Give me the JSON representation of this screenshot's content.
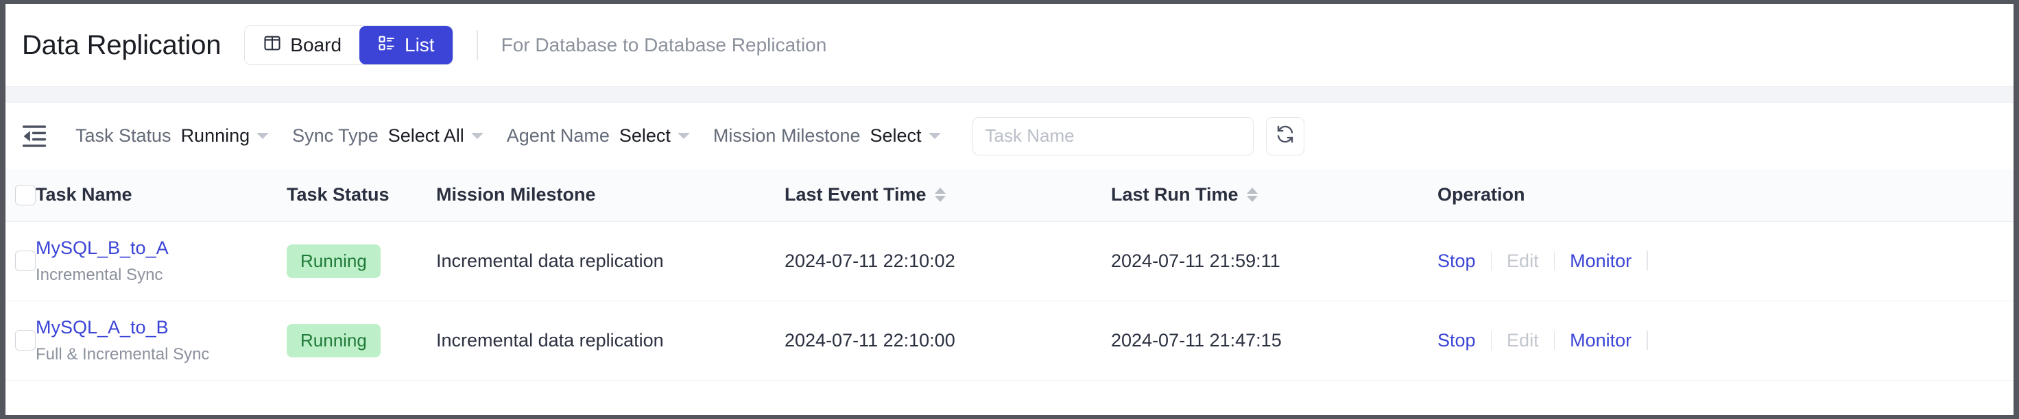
{
  "header": {
    "title": "Data Replication",
    "views": [
      {
        "label": "Board",
        "icon": "board-icon",
        "active": false
      },
      {
        "label": "List",
        "icon": "list-icon",
        "active": true
      }
    ],
    "subtitle": "For Database to Database Replication"
  },
  "filters": {
    "collapse_icon": "collapse-sidebar-icon",
    "items": [
      {
        "label": "Task Status",
        "value": "Running"
      },
      {
        "label": "Sync Type",
        "value": "Select All"
      },
      {
        "label": "Agent Name",
        "value": "Select"
      },
      {
        "label": "Mission Milestone",
        "value": "Select"
      }
    ],
    "search": {
      "placeholder": "Task Name",
      "value": ""
    },
    "refresh_icon": "refresh-icon"
  },
  "table": {
    "columns": [
      {
        "key": "name",
        "label": "Task Name",
        "sortable": false
      },
      {
        "key": "status",
        "label": "Task Status",
        "sortable": false
      },
      {
        "key": "mission",
        "label": "Mission Milestone",
        "sortable": false
      },
      {
        "key": "event_time",
        "label": "Last Event Time",
        "sortable": true
      },
      {
        "key": "run_time",
        "label": "Last Run Time",
        "sortable": true
      },
      {
        "key": "operation",
        "label": "Operation",
        "sortable": false
      }
    ],
    "rows": [
      {
        "name": "MySQL_B_to_A",
        "sub": "Incremental Sync",
        "status": "Running",
        "mission": "Incremental data replication",
        "event_time": "2024-07-11 22:10:02",
        "run_time": "2024-07-11 21:59:11",
        "operations": [
          {
            "label": "Stop",
            "disabled": false
          },
          {
            "label": "Edit",
            "disabled": true
          },
          {
            "label": "Monitor",
            "disabled": false
          }
        ]
      },
      {
        "name": "MySQL_A_to_B",
        "sub": "Full & Incremental Sync",
        "status": "Running",
        "mission": "Incremental data replication",
        "event_time": "2024-07-11 22:10:00",
        "run_time": "2024-07-11 21:47:15",
        "operations": [
          {
            "label": "Stop",
            "disabled": false
          },
          {
            "label": "Edit",
            "disabled": true
          },
          {
            "label": "Monitor",
            "disabled": false
          }
        ]
      }
    ]
  },
  "colors": {
    "accent": "#3b44d6",
    "status_badge_bg": "#bdf0c8",
    "status_badge_text": "#1f7a38",
    "muted_text": "#8b919c"
  }
}
